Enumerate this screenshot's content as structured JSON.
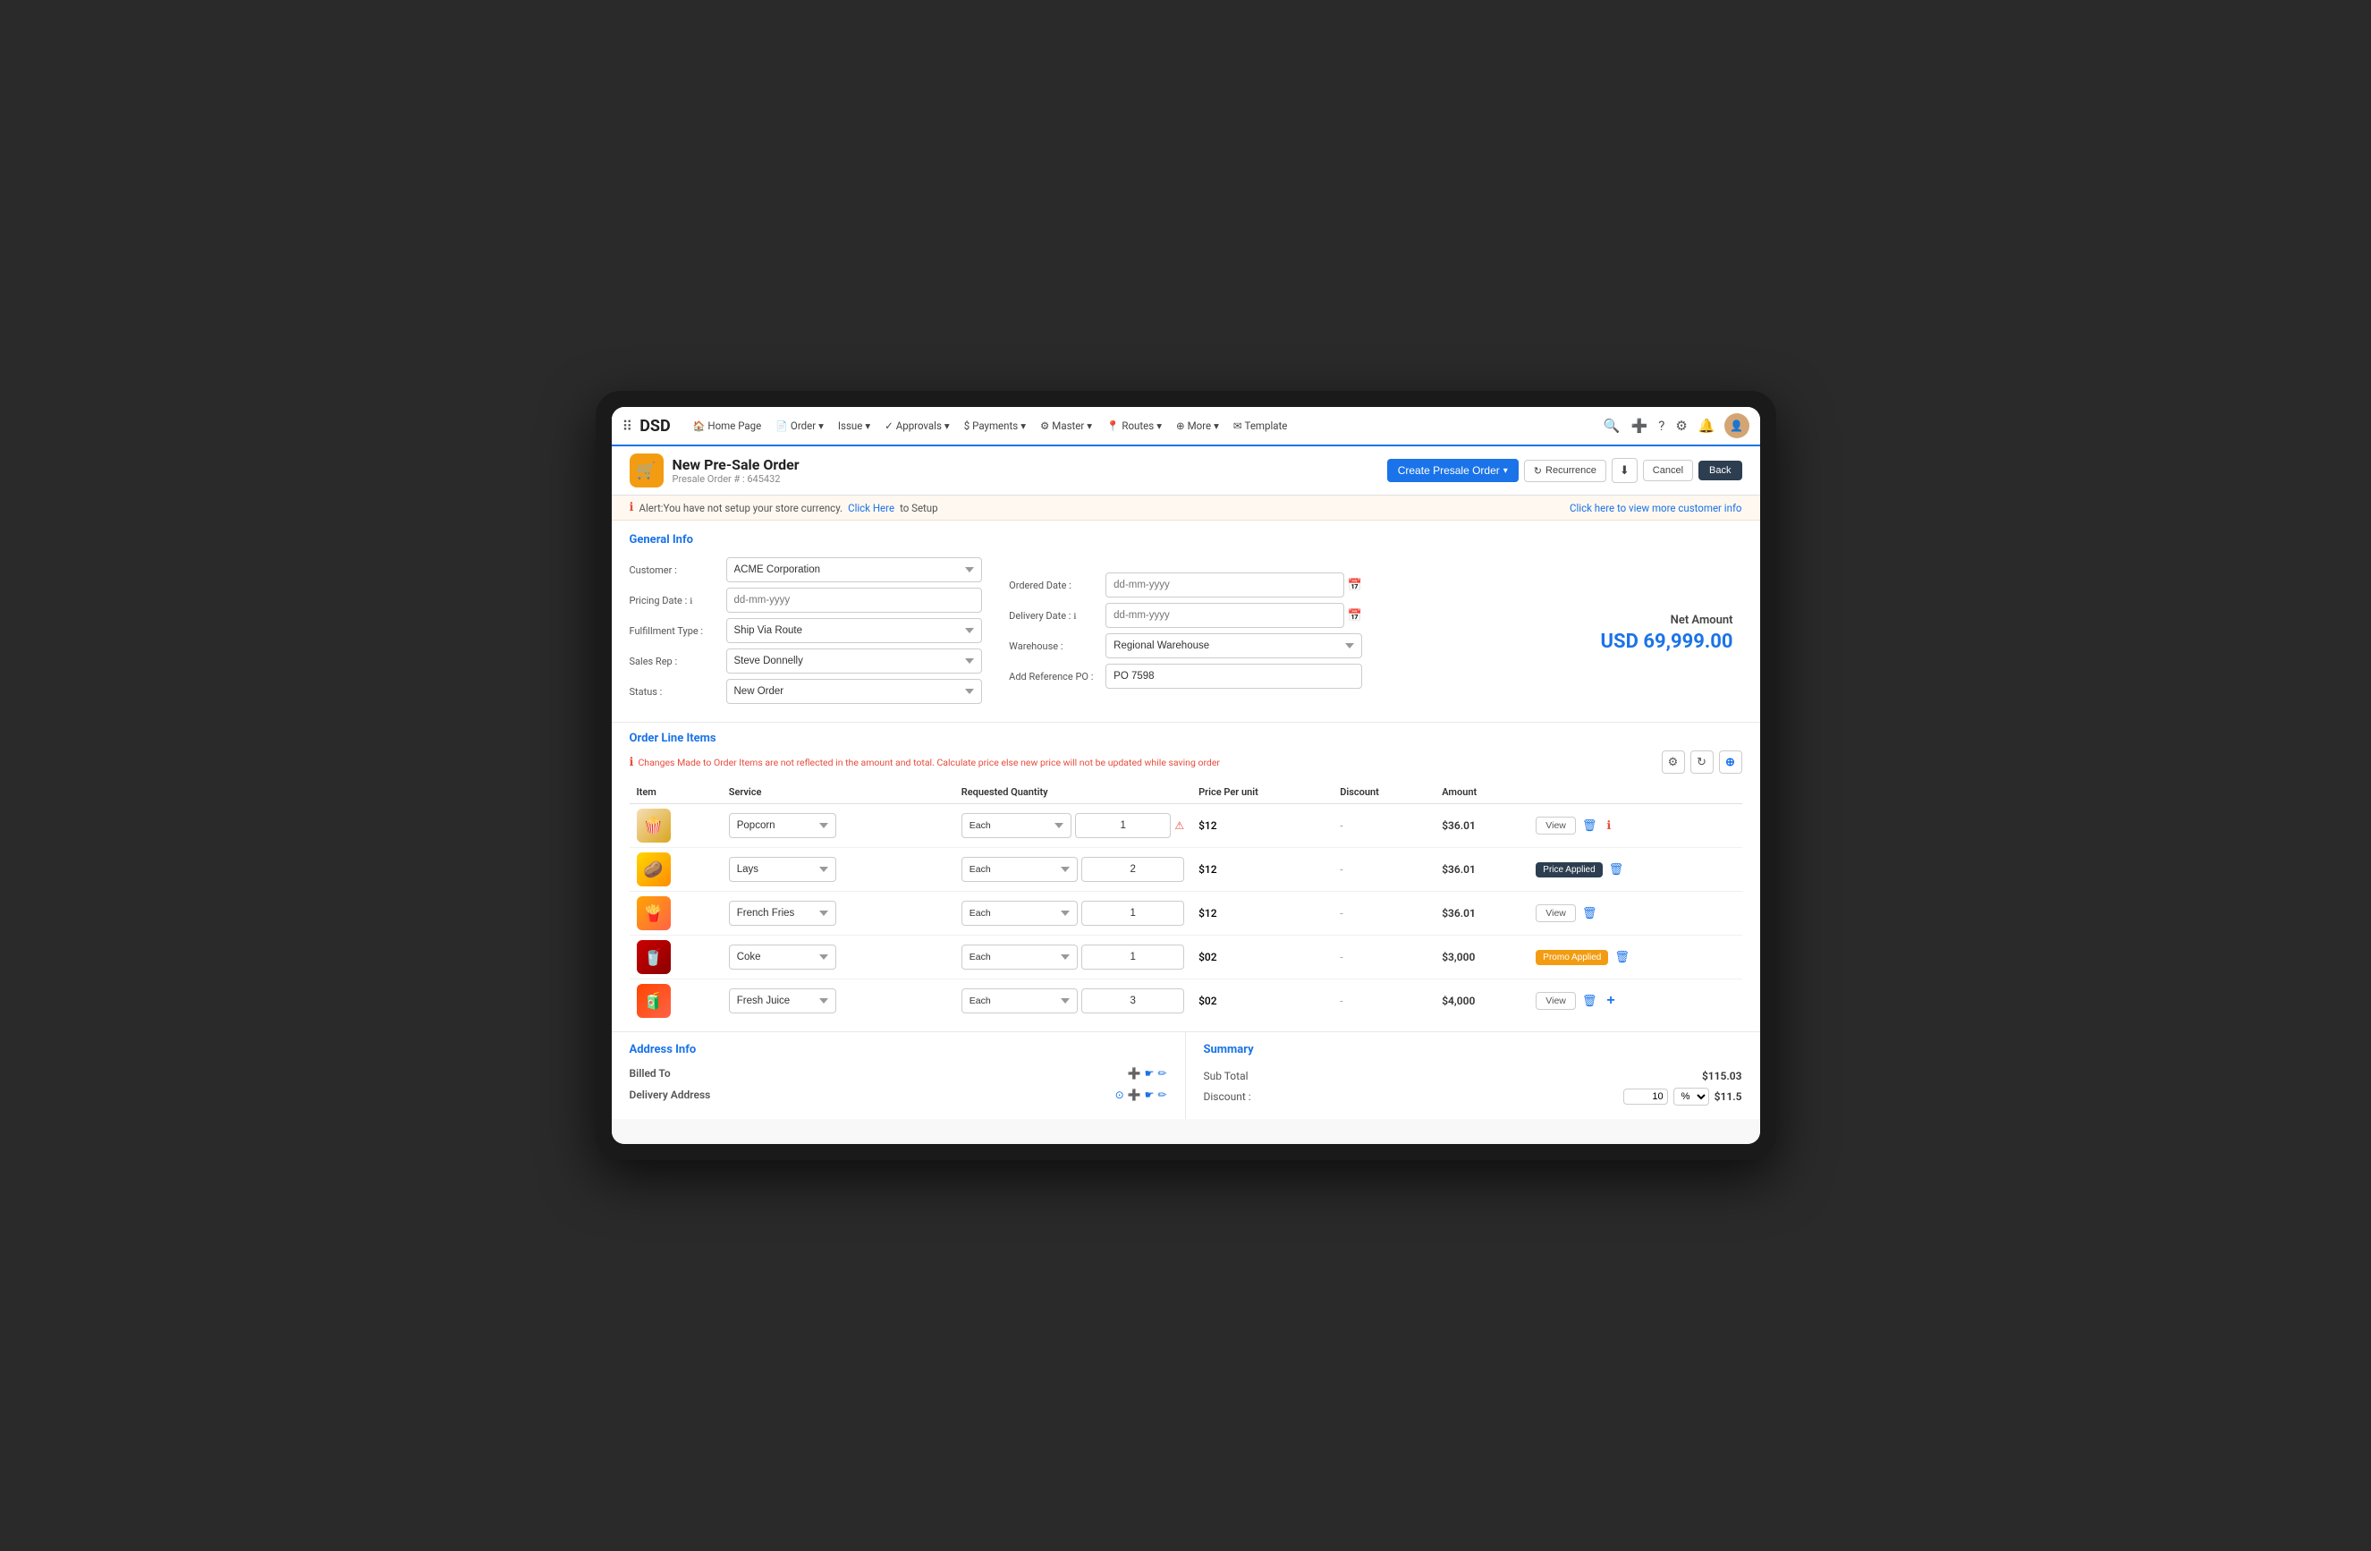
{
  "nav": {
    "brand": "DSD",
    "items": [
      {
        "label": "Home Page",
        "icon": "🏠"
      },
      {
        "label": "Order",
        "icon": "📄",
        "has_arrow": true
      },
      {
        "label": "Issue",
        "icon": "⚑",
        "has_arrow": true
      },
      {
        "label": "Approvals",
        "icon": "✓",
        "has_arrow": true
      },
      {
        "label": "Payments",
        "icon": "$",
        "has_arrow": true
      },
      {
        "label": "Master",
        "icon": "⚙",
        "has_arrow": true
      },
      {
        "label": "Routes",
        "icon": "📍",
        "has_arrow": true
      },
      {
        "label": "More",
        "icon": "⊕",
        "has_arrow": true
      },
      {
        "label": "Template",
        "icon": "✉"
      }
    ]
  },
  "page": {
    "title": "New Pre-Sale Order",
    "subtitle": "Presale Order # : 645432",
    "icon": "🛒"
  },
  "header_actions": {
    "create_btn": "Create Presale Order",
    "recurrence_btn": "Recurrence",
    "cancel_btn": "Cancel",
    "back_btn": "Back"
  },
  "alert": {
    "text": "Alert:You have not setup your store currency.",
    "link_text": "Click Here",
    "link_suffix": "to Setup",
    "right_link": "Click here to view more customer info"
  },
  "general_info": {
    "title": "General Info",
    "customer_label": "Customer :",
    "customer_value": "ACME Corporation",
    "ordered_date_label": "Ordered Date :",
    "ordered_date_placeholder": "dd-mm-yyyy",
    "delivery_date_label": "Delivery Date :",
    "delivery_date_placeholder": "dd-mm-yyyy",
    "pricing_date_label": "Pricing Date :",
    "pricing_date_placeholder": "dd-mm-yyyy",
    "fulfillment_label": "Fulfillment Type :",
    "fulfillment_value": "Ship Via Route",
    "warehouse_label": "Warehouse :",
    "warehouse_value": "Regional Warehouse",
    "sales_rep_label": "Sales Rep :",
    "sales_rep_value": "Steve Donnelly",
    "reference_po_label": "Add Reference PO :",
    "reference_po_value": "PO 7598",
    "status_label": "Status :",
    "status_value": "New Order",
    "net_amount_label": "Net Amount",
    "net_amount_value": "USD 69,999.00"
  },
  "order_line": {
    "title": "Order Line Items",
    "warning": "Changes Made to Order Items are not reflected in the amount and total. Calculate price else new price will not be updated while saving order",
    "columns": [
      "Item",
      "Service",
      "Requested Quantity",
      "Price Per unit",
      "Discount",
      "Amount"
    ],
    "items": [
      {
        "id": 1,
        "thumb_class": "thumb-popcorn",
        "thumb_emoji": "🍿",
        "service": "Popcorn",
        "unit": "Each",
        "qty": "1",
        "price": "$12",
        "discount": "-",
        "amount": "$36.01",
        "action_type": "view",
        "has_warning": true
      },
      {
        "id": 2,
        "thumb_class": "thumb-lays",
        "thumb_emoji": "🥔",
        "service": "Lays",
        "unit": "Each",
        "qty": "2",
        "price": "$12",
        "discount": "-",
        "amount": "$36.01",
        "action_type": "price_applied",
        "has_warning": false
      },
      {
        "id": 3,
        "thumb_class": "thumb-fries",
        "thumb_emoji": "🍟",
        "service": "French Fries",
        "unit": "Each",
        "qty": "1",
        "price": "$12",
        "discount": "-",
        "amount": "$36.01",
        "action_type": "view",
        "has_warning": false
      },
      {
        "id": 4,
        "thumb_class": "thumb-coke",
        "thumb_emoji": "🥤",
        "service": "Coke",
        "unit": "Each",
        "qty": "1",
        "price": "$02",
        "discount": "-",
        "amount": "$3,000",
        "action_type": "promo_applied",
        "has_warning": false
      },
      {
        "id": 5,
        "thumb_class": "thumb-juice",
        "thumb_emoji": "🧃",
        "service": "Fresh Juice",
        "unit": "Each",
        "qty": "3",
        "price": "$02",
        "discount": "-",
        "amount": "$4,000",
        "action_type": "view_add",
        "has_warning": false
      }
    ]
  },
  "address": {
    "title": "Address Info",
    "billed_to": "Billed To",
    "delivery_address": "Delivery Address"
  },
  "summary": {
    "title": "Summary",
    "sub_total_label": "Sub Total",
    "sub_total_value": "$115.03",
    "discount_label": "Discount :",
    "discount_amount": "$11.5",
    "discount_value": "10",
    "discount_unit": "%"
  }
}
